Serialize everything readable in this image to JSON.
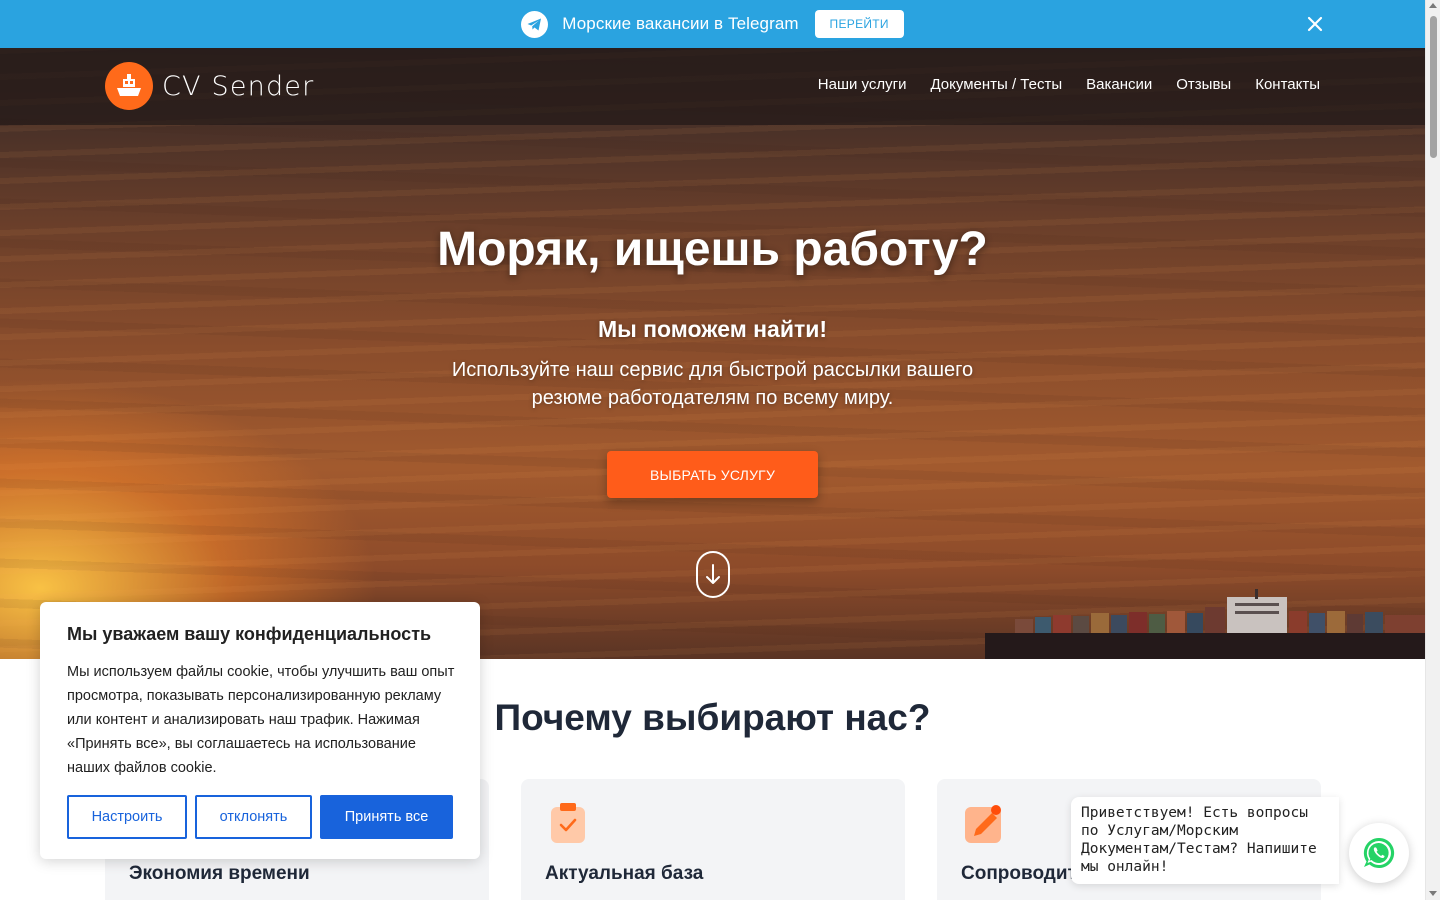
{
  "telegram_bar": {
    "text": "Морские вакансии в Telegram",
    "button_label": "ПЕРЕЙТИ",
    "icon": "telegram-icon",
    "close_icon": "close-icon"
  },
  "header": {
    "logo_text": "CV Sender",
    "nav": [
      "Наши услуги",
      "Документы / Тесты",
      "Вакансии",
      "Отзывы",
      "Контакты"
    ]
  },
  "hero": {
    "title": "Моряк, ищешь работу?",
    "subtitle": "Мы поможем найти!",
    "description": "Используйте наш сервис для быстрой рассылки вашего резюме работодателям по всему миру.",
    "cta_label": "ВЫБРАТЬ УСЛУГУ",
    "scroll_icon": "scroll-down-icon"
  },
  "why": {
    "title": "Почему выбирают нас?",
    "cards": [
      {
        "title": "Экономия времени",
        "icon": "clock-icon"
      },
      {
        "title": "Актуальная база",
        "icon": "clipboard-check-icon"
      },
      {
        "title": "Сопроводит",
        "icon": "pencil-icon"
      }
    ]
  },
  "cookie": {
    "title": "Мы уважаем вашу конфиденциальность",
    "text": "Мы используем файлы cookie, чтобы улучшить ваш опыт просмотра, показывать персонализированную рекламу или контент и анализировать наш трафик. Нажимая «Принять все», вы соглашаетесь на использование наших файлов cookie.",
    "settings_label": "Настроить",
    "reject_label": "отклонять",
    "accept_label": "Принять все"
  },
  "chat": {
    "message": "Приветствуем! Есть вопросы по Услугам/Морским Документам/Тестам? Напишите мы онлайн!",
    "icon": "whatsapp-icon"
  },
  "colors": {
    "telegram": "#2aa3e0",
    "accent": "#ff5c1a",
    "cookie_blue": "#1863dc",
    "whatsapp": "#25d366"
  }
}
